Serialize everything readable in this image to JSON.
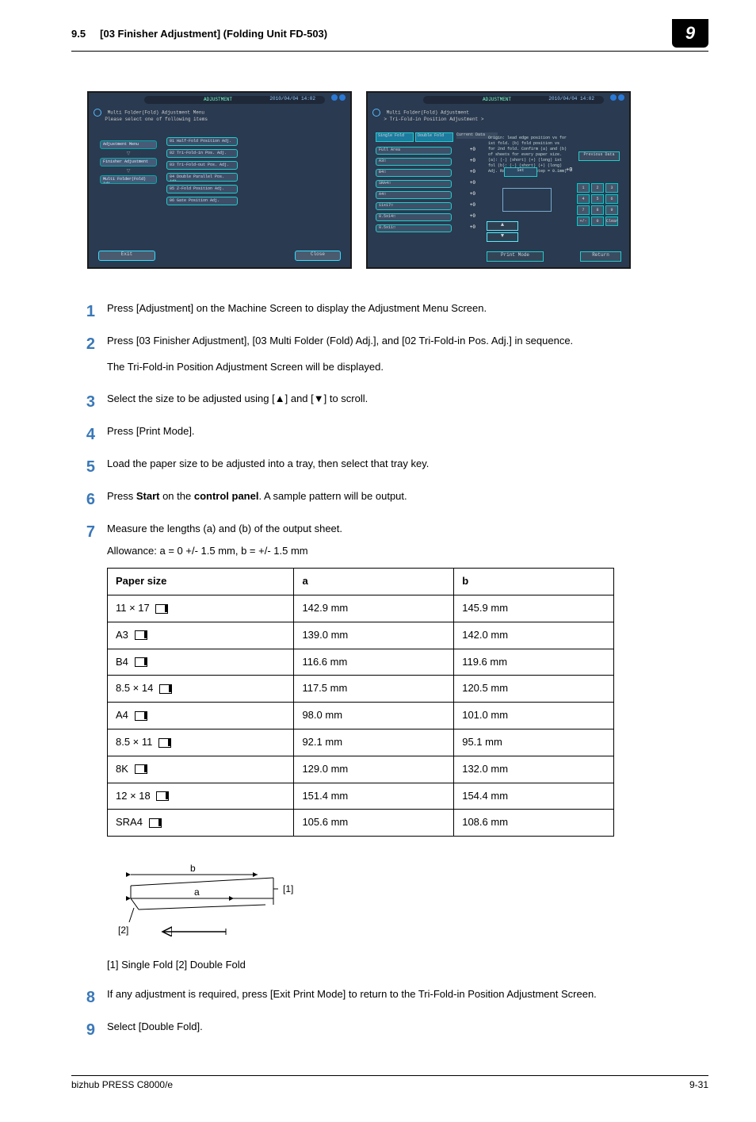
{
  "header": {
    "section_no": "9.5",
    "section_title": "[03 Finisher Adjustment] (Folding Unit FD-503)",
    "chapter_badge": "9"
  },
  "screens": {
    "left": {
      "mode_label": "ADJUSTMENT",
      "date": "2010/04/04 14:02",
      "title_line1": "Multi Folder(Fold) Adjustment Menu",
      "title_line2": "Please select one of following items",
      "sidebar": [
        "Adjustment Menu",
        "Finisher Adjustment",
        "Multi Folder(Fold) Adj."
      ],
      "midlist": [
        "01 Half-Fold Position Adj.",
        "02 Tri-Fold-in Pos. Adj.",
        "03 Tri-Fold-out Pos. Adj.",
        "04 Double Parallel Pos. Adj.",
        "05 Z-Fold Position Adj.",
        "06 Gate Position Adj."
      ],
      "exit": "Exit",
      "close": "Close"
    },
    "right": {
      "mode_label": "ADJUSTMENT",
      "date": "2010/04/04 14:02",
      "title_line1": "Multi Folder(Fold) Adjustment",
      "title_line2": "> Tri-Fold-in Position Adjustment >",
      "tabs": [
        "Single Fold",
        "Double Fold"
      ],
      "current_data": "Current Data",
      "rows": [
        {
          "k": "Full Area",
          "v": "+0"
        },
        {
          "k": "A3□",
          "v": "+0"
        },
        {
          "k": "B4□",
          "v": "+0"
        },
        {
          "k": "SRA4□",
          "v": "+0"
        },
        {
          "k": "A4□",
          "v": "+0"
        },
        {
          "k": "11x17□",
          "v": "+0"
        },
        {
          "k": "8.5x14□",
          "v": "+0"
        },
        {
          "k": "8.5x11□",
          "v": "+0"
        }
      ],
      "info": "Origin: lead edge position vs for 1st fold. (b) fold position vs for 2nd fold. Confirm (a) and (b) of sheets for every paper size. (a): (-) (short) (+) (long) 1st fol (b): (-) (short) (+) (long) Adj. Range:-50~+50(1step = 0.1mm)",
      "set": "Set",
      "num_display": "+0",
      "previous_data": "Previous Data",
      "print_mode": "Print Mode",
      "return": "Return",
      "keypad": [
        "1",
        "2",
        "3",
        "4",
        "5",
        "6",
        "7",
        "8",
        "9",
        "+/-",
        "0",
        "Clear"
      ]
    }
  },
  "steps": [
    {
      "text": "Press [Adjustment] on the Machine Screen to display the Adjustment Menu Screen."
    },
    {
      "text": "Press [03 Finisher Adjustment], [03 Multi Folder (Fold) Adj.], and [02 Tri-Fold-in Pos. Adj.] in sequence.",
      "sub": "The Tri-Fold-in Position Adjustment Screen will be displayed."
    },
    {
      "text": "Select the size to be adjusted using [▲] and [▼] to scroll."
    },
    {
      "text": "Press [Print Mode]."
    },
    {
      "text": "Load the paper size to be adjusted into a tray, then select that tray key."
    },
    {
      "html": true,
      "prefix": "Press ",
      "bold1": "Start",
      "mid": " on the ",
      "bold2": "control panel",
      "suffix": ". A sample pattern will be output."
    },
    {
      "text": "Measure the lengths (a) and (b) of the output sheet.",
      "allowance": "Allowance: a = 0 +/- 1.5 mm, b = +/- 1.5 mm"
    }
  ],
  "chart_data": {
    "type": "table",
    "headers": [
      "Paper size",
      "a",
      "b"
    ],
    "rows": [
      {
        "size": "11 × 17",
        "a": "142.9 mm",
        "b": "145.9 mm"
      },
      {
        "size": "A3",
        "a": "139.0 mm",
        "b": "142.0 mm"
      },
      {
        "size": "B4",
        "a": "116.6 mm",
        "b": "119.6 mm"
      },
      {
        "size": "8.5 × 14",
        "a": "117.5 mm",
        "b": "120.5 mm"
      },
      {
        "size": "A4",
        "a": "98.0 mm",
        "b": "101.0 mm"
      },
      {
        "size": "8.5 × 11",
        "a": "92.1 mm",
        "b": "95.1 mm"
      },
      {
        "size": "8K",
        "a": "129.0 mm",
        "b": "132.0 mm"
      },
      {
        "size": "12 × 18",
        "a": "151.4 mm",
        "b": "154.4 mm"
      },
      {
        "size": "SRA4",
        "a": "105.6 mm",
        "b": "108.6 mm"
      }
    ]
  },
  "diagram": {
    "label_a": "a",
    "label_b": "b",
    "mark1": "[1]",
    "mark2": "[2]",
    "caption": "[1] Single Fold [2] Double Fold"
  },
  "steps_after": [
    {
      "n": "8",
      "text": "If any adjustment is required, press [Exit Print Mode] to return to the Tri-Fold-in Position Adjustment Screen."
    },
    {
      "n": "9",
      "text": "Select [Double Fold]."
    }
  ],
  "footer": {
    "product": "bizhub PRESS C8000/e",
    "page": "9-31"
  }
}
